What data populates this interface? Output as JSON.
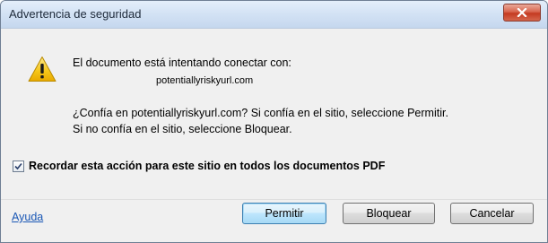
{
  "dialog": {
    "title": "Advertencia de seguridad",
    "close_icon": "close-icon",
    "warning_icon": "warning-icon",
    "message": "El documento está intentando conectar con:",
    "url": "potentiallyriskyurl.com",
    "question_line1": "¿Confía en potentiallyriskyurl.com? Si confía en el sitio, seleccione Permitir.",
    "question_line2": "Si no confía en  el sitio, seleccione Bloquear.",
    "remember_checkbox": {
      "label": "Recordar esta acción para este sitio en todos los documentos PDF",
      "checked": true
    },
    "help_link": "Ayuda",
    "buttons": {
      "permit": "Permitir",
      "block": "Bloquear",
      "cancel": "Cancelar"
    }
  },
  "colors": {
    "titlebar": "#d4e3f5",
    "close_button": "#c43a21",
    "link": "#1a57b5",
    "warning_yellow": "#f5c518"
  }
}
